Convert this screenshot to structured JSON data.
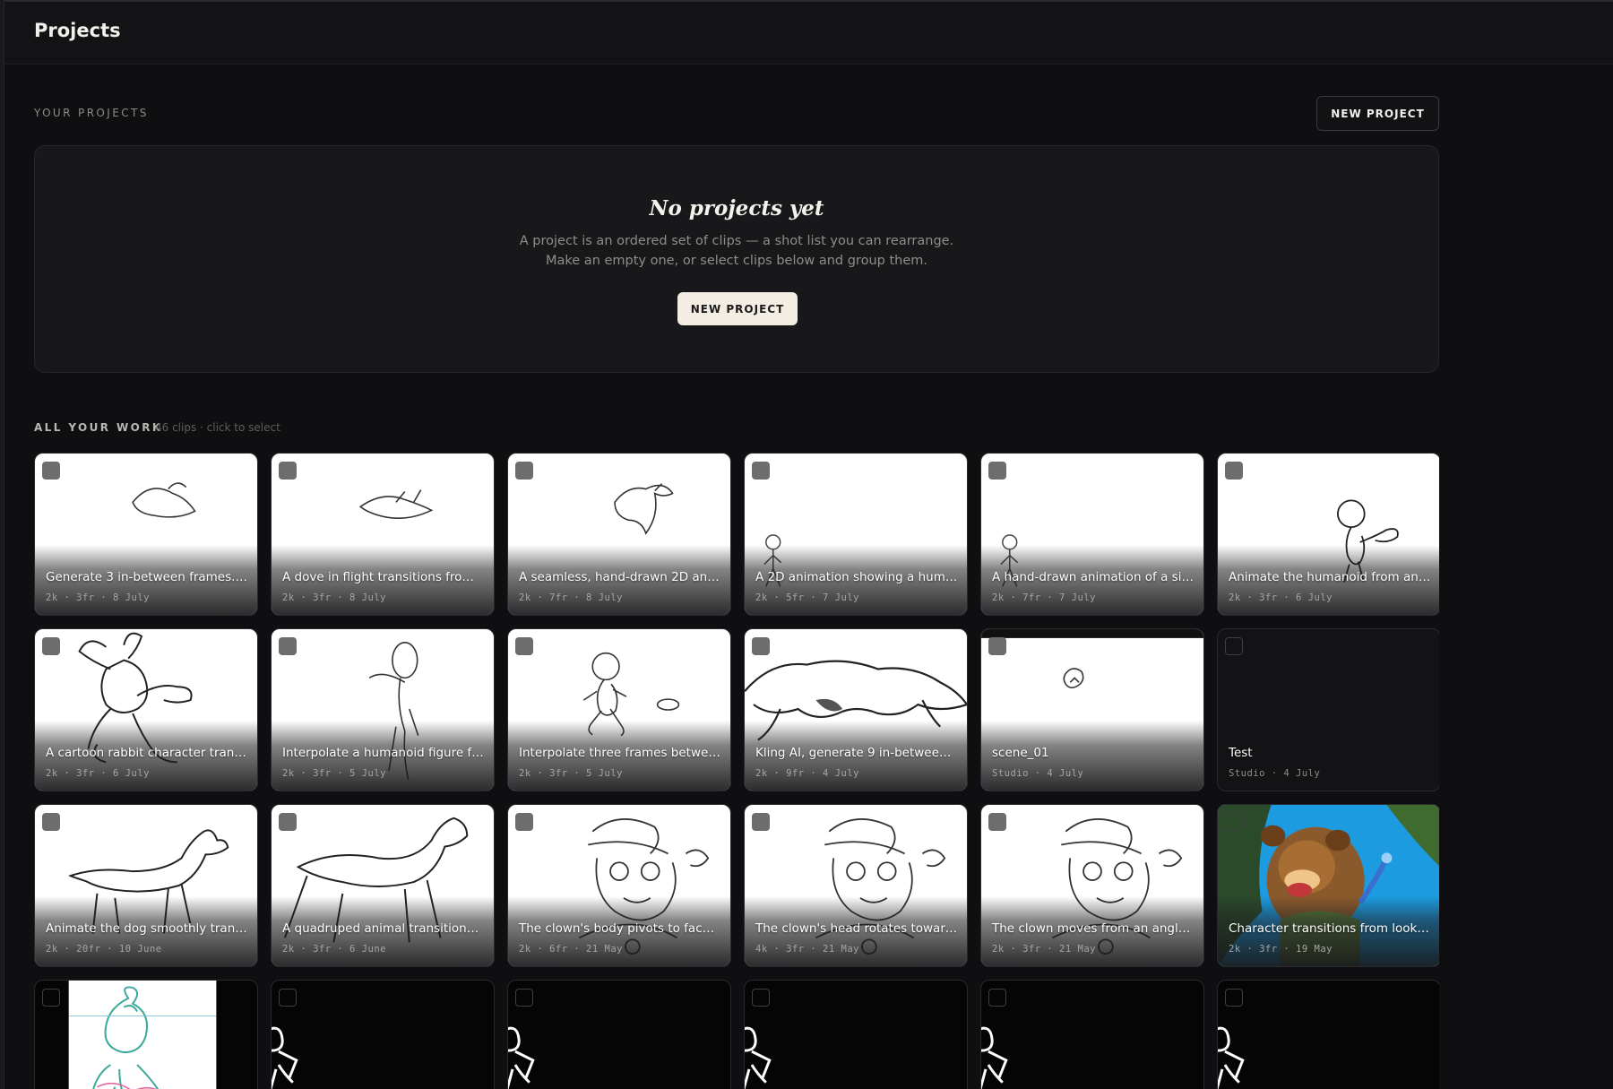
{
  "header": {
    "title": "Projects"
  },
  "projects": {
    "section_label": "YOUR PROJECTS",
    "new_project_label": "NEW PROJECT",
    "empty": {
      "title": "No projects yet",
      "line1": "A project is an ordered set of clips — a shot list you can rearrange.",
      "line2": "Make an empty one, or select clips below and group them.",
      "button_label": "NEW PROJECT"
    }
  },
  "work": {
    "section_label": "ALL YOUR WORK",
    "subtitle": "46 clips · click to select",
    "clips": [
      {
        "caption": "Generate 3 in-between frames. Th…",
        "meta": "2k · 3fr · 8 July",
        "style": "sketch",
        "art": "bird1"
      },
      {
        "caption": "A dove in flight transitions from an …",
        "meta": "2k · 3fr · 8 July",
        "style": "sketch",
        "art": "bird2"
      },
      {
        "caption": "A seamless, hand-drawn 2D anima…",
        "meta": "2k · 7fr · 8 July",
        "style": "sketch",
        "art": "bird3"
      },
      {
        "caption": "A 2D animation showing a humanoi…",
        "meta": "2k · 5fr · 7 July",
        "style": "sketch",
        "art": "walker"
      },
      {
        "caption": "A hand-drawn animation of a simpl…",
        "meta": "2k · 7fr · 7 July",
        "style": "sketch",
        "art": "walker"
      },
      {
        "caption": "Animate the humanoid from an air…",
        "meta": "2k · 3fr · 6 July",
        "style": "sketch",
        "art": "humanoid"
      },
      {
        "caption": "A cartoon rabbit character transiti…",
        "meta": "2k · 3fr · 6 July",
        "style": "sketch",
        "art": "rabbit"
      },
      {
        "caption": "Interpolate a humanoid figure from…",
        "meta": "2k · 3fr · 5 July",
        "style": "sketch",
        "art": "figure"
      },
      {
        "caption": "Interpolate three frames between …",
        "meta": "2k · 3fr · 5 July",
        "style": "sketch",
        "art": "runner"
      },
      {
        "caption": "Kling AI, generate 9 in-between fra…",
        "meta": "2k · 9fr · 4 July",
        "style": "sketch",
        "art": "wolf"
      },
      {
        "caption": "scene_01",
        "meta": "Studio · 4 July",
        "style": "sketch",
        "art": "scene"
      },
      {
        "caption": "Test",
        "meta": "Studio · 4 July",
        "style": "dark",
        "art": "none"
      },
      {
        "caption": "Animate the dog smoothly transiti…",
        "meta": "2k · 20fr · 10 June",
        "style": "sketch",
        "art": "dog"
      },
      {
        "caption": "A quadruped animal transitions fro…",
        "meta": "2k · 3fr · 6 June",
        "style": "sketch",
        "art": "deer"
      },
      {
        "caption": "The clown's body pivots to face for…",
        "meta": "2k · 6fr · 21 May",
        "style": "sketch",
        "art": "clown"
      },
      {
        "caption": "The clown's head rotates towards t…",
        "meta": "4k · 3fr · 21 May",
        "style": "sketch",
        "art": "clown"
      },
      {
        "caption": "The clown moves from an angled-r…",
        "meta": "2k · 3fr · 21 May",
        "style": "sketch",
        "art": "clown"
      },
      {
        "caption": "Character transitions from looking …",
        "meta": "2k · 3fr · 19 May",
        "style": "photo",
        "art": "bear"
      },
      {
        "caption": "",
        "meta": "",
        "style": "black",
        "art": "squid"
      },
      {
        "caption": "",
        "meta": "",
        "style": "black",
        "art": "stick"
      },
      {
        "caption": "",
        "meta": "",
        "style": "black",
        "art": "stick"
      },
      {
        "caption": "",
        "meta": "",
        "style": "black",
        "art": "stick"
      },
      {
        "caption": "",
        "meta": "",
        "style": "black",
        "art": "stick"
      },
      {
        "caption": "",
        "meta": "",
        "style": "black",
        "art": "stick"
      }
    ]
  },
  "colors": {
    "background": "#0f0f12",
    "card": "#18181b",
    "accent_button": "#f3ede3",
    "text_primary": "#f2f0ea",
    "text_muted": "#8f8d88"
  }
}
